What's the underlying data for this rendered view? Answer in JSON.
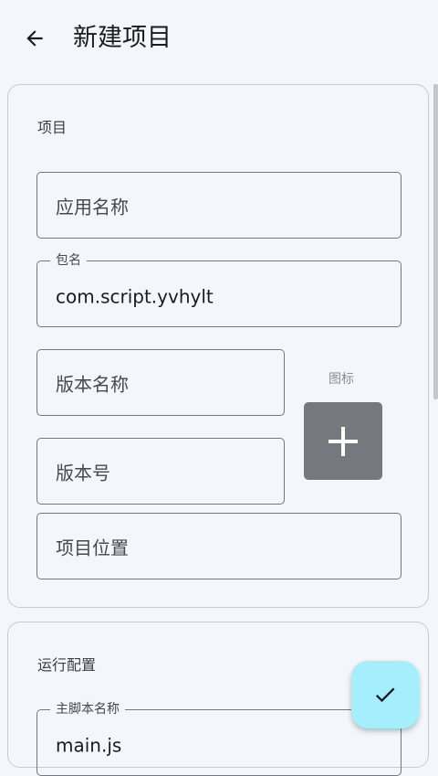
{
  "appbar": {
    "title": "新建项目"
  },
  "project_section": {
    "title": "项目",
    "app_name": {
      "placeholder": "应用名称"
    },
    "package": {
      "label": "包名",
      "value": "com.script.yvhylt"
    },
    "version_name": {
      "placeholder": "版本名称"
    },
    "version_code": {
      "placeholder": "版本号"
    },
    "project_location": {
      "placeholder": "项目位置"
    },
    "icon": {
      "label": "图标",
      "icon": "plus-icon"
    }
  },
  "run_config_section": {
    "title": "运行配置",
    "main_script": {
      "label": "主脚本名称",
      "value": "main.js"
    }
  },
  "fab": {
    "icon": "check-icon",
    "color": "#a5eefc"
  }
}
